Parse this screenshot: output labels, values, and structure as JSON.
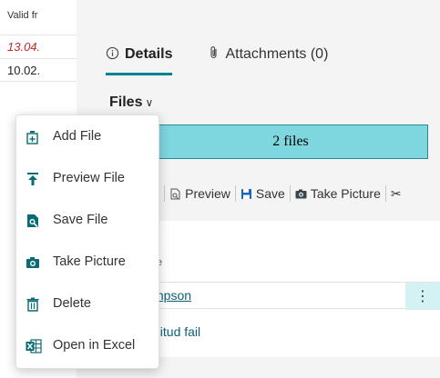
{
  "list": {
    "column_header": "Valid fr",
    "rows": [
      "13.04.",
      "10.02."
    ]
  },
  "tabs": [
    {
      "label": "Details",
      "icon": "info-icon"
    },
    {
      "label": "Attachments (0)",
      "icon": "paperclip-icon"
    }
  ],
  "files": {
    "heading": "Files",
    "chevron": "∨",
    "bar_label": "2 files"
  },
  "toolbar": {
    "partial_label": "l",
    "preview_label": "Preview",
    "save_label": "Save",
    "take_picture_label": "Take Picture",
    "cut_glyph": "✂"
  },
  "grid": {
    "column_header": "e",
    "rows": [
      "mpson",
      "ditud fail"
    ],
    "more_glyph": "⋮"
  },
  "menu": {
    "items": [
      {
        "label": "Add File",
        "icon": "add-file-icon"
      },
      {
        "label": "Preview File",
        "icon": "upload-arrow-icon"
      },
      {
        "label": "Save File",
        "icon": "save-file-icon"
      },
      {
        "label": "Take Picture",
        "icon": "camera-icon"
      },
      {
        "label": "Delete",
        "icon": "trash-icon"
      },
      {
        "label": "Open in Excel",
        "icon": "excel-icon"
      }
    ]
  },
  "colors": {
    "accent": "#00838f",
    "files_bar": "#7ed6df",
    "link": "#0b5f78",
    "error": "#c62828"
  }
}
